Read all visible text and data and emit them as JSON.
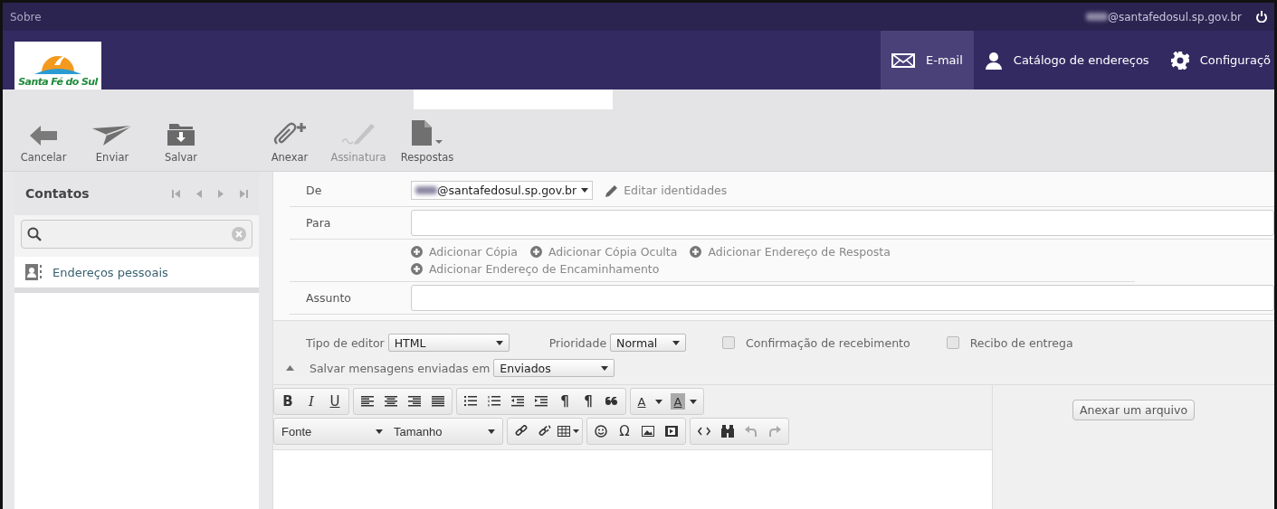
{
  "top_bar": {
    "link": "Sobre",
    "user_email": "@santafedosul.sp.gov.br"
  },
  "logo": {
    "text": "Santa Fé do Sul"
  },
  "nav": [
    {
      "label": "E-mail",
      "selected": true
    },
    {
      "label": "Catálogo de endereços",
      "selected": false
    },
    {
      "label": "Configuraçõ",
      "selected": false
    }
  ],
  "toolbar": [
    {
      "label": "Cancelar",
      "disabled": false
    },
    {
      "label": "Enviar",
      "disabled": false
    },
    {
      "label": "Salvar",
      "disabled": false
    },
    {
      "label": "Anexar",
      "disabled": false
    },
    {
      "label": "Assinatura",
      "disabled": true
    },
    {
      "label": "Respostas",
      "disabled": false
    }
  ],
  "contacts": {
    "title": "Contatos",
    "items": [
      {
        "label": "Endereços pessoais",
        "selected": false
      }
    ]
  },
  "compose": {
    "from": {
      "label": "De",
      "value": "@santafedosul.sp.gov.br",
      "edit_link": "Editar identidades"
    },
    "to": {
      "label": "Para"
    },
    "add_links": [
      "Adicionar Cópia",
      "Adicionar Cópia Oculta",
      "Adicionar Endereço de Resposta",
      "Adicionar Endereço de Encaminhamento"
    ],
    "subject": {
      "label": "Assunto"
    }
  },
  "options": {
    "editor_type": {
      "label": "Tipo de editor",
      "value": "HTML"
    },
    "priority": {
      "label": "Prioridade",
      "value": "Normal"
    },
    "checkboxes": [
      {
        "label": "Confirmação de recebimento",
        "checked": false
      },
      {
        "label": "Recibo de entrega",
        "checked": false
      }
    ],
    "save_in": {
      "label": "Salvar mensagens enviadas em",
      "value": "Enviados"
    }
  },
  "editor_toolbar": {
    "format": [
      "B",
      "I",
      "U"
    ],
    "paragraph_marks": [
      "¶",
      "¶"
    ],
    "color_buttons": [
      "A",
      "A"
    ],
    "font_selects": [
      "Fonte",
      "Tamanho"
    ],
    "special_char": "Ω",
    "history": [
      {
        "disabled": true
      },
      {
        "disabled": true
      }
    ]
  },
  "attach_button": "Anexar um arquivo"
}
